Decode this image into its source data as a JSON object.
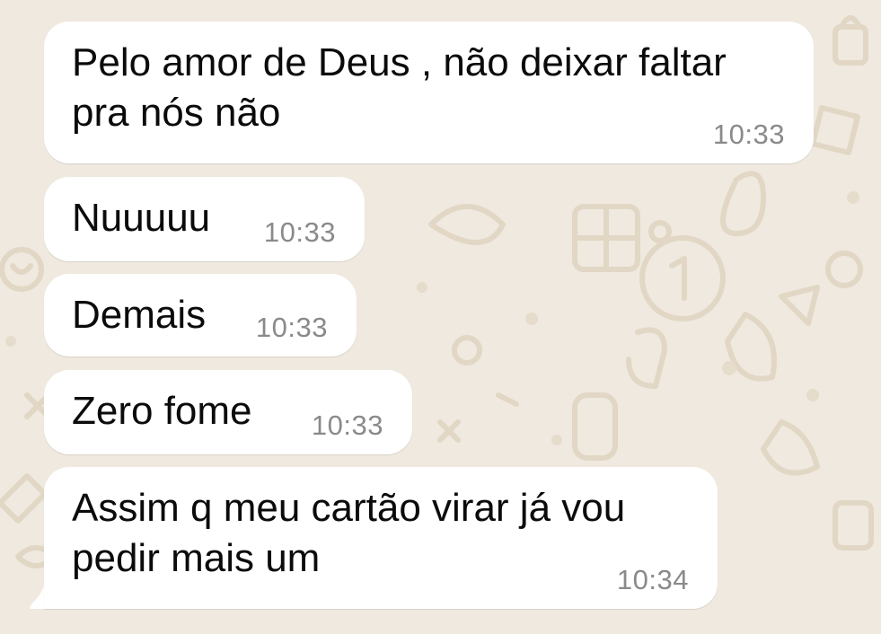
{
  "messages": [
    {
      "text": "Pelo amor de Deus , não deixar faltar\npra nós não",
      "time": "10:33"
    },
    {
      "text": "Nuuuuu",
      "time": "10:33"
    },
    {
      "text": "Demais",
      "time": "10:33"
    },
    {
      "text": "Zero fome",
      "time": "10:33"
    },
    {
      "text": "Assim q meu cartão virar já vou\npedir mais um",
      "time": "10:34"
    }
  ],
  "colors": {
    "background": "#efe9df",
    "bubble": "#ffffff",
    "text": "#0b0b0b",
    "time": "#8a8a8a",
    "doodle": "#e3d9c8"
  }
}
